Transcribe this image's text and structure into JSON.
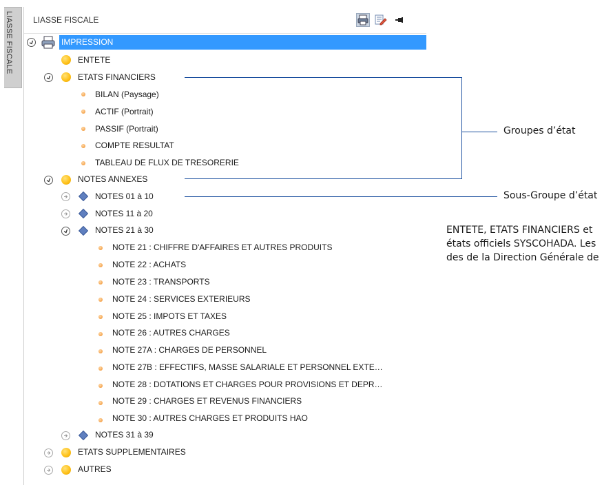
{
  "side_tab": {
    "label": "LIASSE FISCALE"
  },
  "panel": {
    "title": "LIASSE FISCALE",
    "toolbar": {
      "print_icon": "printer-icon",
      "edit_icon": "edit-list-icon",
      "pin_icon": "pin-icon"
    }
  },
  "tree": {
    "root": "IMPRESSION",
    "entete": "ENTETE",
    "etats_financiers": {
      "label": "ETATS FINANCIERS",
      "items": [
        "BILAN (Paysage)",
        "ACTIF (Portrait)",
        "PASSIF (Portrait)",
        "COMPTE RESULTAT",
        "TABLEAU DE FLUX DE TRESORERIE"
      ]
    },
    "notes_annexes": {
      "label": "NOTES ANNEXES",
      "notes_01_10": "NOTES 01 à 10",
      "notes_11_20": "NOTES 11 à 20",
      "notes_21_30": {
        "label": "NOTES 21 à 30",
        "items": [
          "NOTE 21 : CHIFFRE D'AFFAIRES  ET AUTRES PRODUITS",
          "NOTE 22 : ACHATS",
          "NOTE 23 : TRANSPORTS",
          "NOTE 24 : SERVICES EXTERIEURS",
          "NOTE 25 : IMPOTS ET TAXES",
          "NOTE 26 : AUTRES CHARGES",
          "NOTE 27A : CHARGES DE PERSONNEL",
          "NOTE 27B : EFFECTIFS, MASSE SALARIALE ET PERSONNEL EXTE…",
          "NOTE 28 : DOTATIONS ET CHARGES POUR PROVISIONS ET DEPR…",
          "NOTE 29 : CHARGES ET REVENUS FINANCIERS",
          "NOTE 30 : AUTRES  CHARGES ET PRODUITS HAO"
        ]
      },
      "notes_31_39": "NOTES 31 à 39"
    },
    "etats_supplementaires": "ETATS SUPPLEMENTAIRES",
    "autres": "AUTRES"
  },
  "annotations": {
    "groupes": "Groupes d’état",
    "sous_groupe": "Sous-Groupe d’état",
    "description_lines": [
      "ENTETE, ETATS FINANCIERS et",
      "états officiels SYSCOHADA. Les",
      "des de la Direction Générale de"
    ]
  },
  "colors": {
    "selection": "#3399ff",
    "connector": "#1a4e9e",
    "ball": "#ffc21a",
    "diamond": "#5f7fbf"
  }
}
